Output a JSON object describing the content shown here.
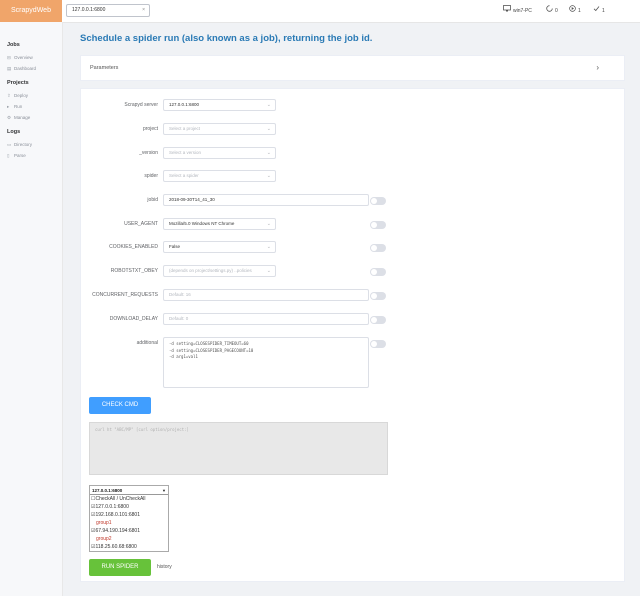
{
  "app": {
    "logo": "ScrapydWeb"
  },
  "topbar": {
    "server_tab": "127.0.0.1:6800",
    "close": "×",
    "pc_label": "win7-PC",
    "pending": "0",
    "running": "1",
    "finished": "1"
  },
  "sidebar": {
    "sections": [
      {
        "title": "Jobs",
        "items": [
          "Overview",
          "Dashboard"
        ]
      },
      {
        "title": "Projects",
        "items": [
          "Deploy",
          "Run",
          "Manage"
        ]
      },
      {
        "title": "Logs",
        "items": [
          "Directory",
          "Parse"
        ]
      }
    ]
  },
  "page": {
    "title": "Schedule a spider run (also known as a job), returning the job id."
  },
  "parameters": {
    "label": "Parameters",
    "chevron": "›"
  },
  "form": {
    "fields": [
      {
        "label": "Scrapyd server",
        "value": "127.0.0.1:6800",
        "placeholder": false,
        "arrow": true
      },
      {
        "label": "project",
        "value": "Select a project",
        "placeholder": true,
        "arrow": true
      },
      {
        "label": "_version",
        "value": "Select a version",
        "placeholder": true,
        "arrow": true
      },
      {
        "label": "spider",
        "value": "Select a spider",
        "placeholder": true,
        "arrow": true
      },
      {
        "label": "jobid",
        "value": "2018-09-30T14_41_30",
        "placeholder": false,
        "arrow": false
      },
      {
        "label": "USER_AGENT",
        "value": "Mozilla/5.0 Windows NT Chrome",
        "placeholder": false,
        "arrow": true
      },
      {
        "label": "COOKIES_ENABLED",
        "value": "False",
        "placeholder": false,
        "arrow": true
      },
      {
        "label": "ROBOTSTXT_OBEY",
        "value": "(depends on project/settings.py) ..policies",
        "placeholder": true,
        "arrow": true
      },
      {
        "label": "CONCURRENT_REQUESTS",
        "value": "Default: 16",
        "placeholder": true,
        "arrow": false
      },
      {
        "label": "DOWNLOAD_DELAY",
        "value": "Default: 0",
        "placeholder": true,
        "arrow": false
      }
    ],
    "additional": {
      "label": "additional",
      "lines": [
        "-d setting=CLOSESPIDER_TIMEOUT=60",
        "-d setting=CLOSESPIDER_PAGECOUNT=10",
        "-d arg1=val1"
      ]
    }
  },
  "buttons": {
    "check_cmd": "CHECK CMD",
    "run_spider": "RUN SPIDER",
    "history": "history"
  },
  "cmd_preview": "curl ht  \"ABC/MP\"  [curl option/project:]",
  "nodes": {
    "selected": "127.0.0.1:6800",
    "arrow": "▼",
    "options": [
      {
        "text": "☐CheckAll / UnCheckAll",
        "group": false
      },
      {
        "text": "☑127.0.0.1:6800",
        "group": false
      },
      {
        "text": "☑192.168.0.101:6801",
        "group": false
      },
      {
        "text": "group1",
        "group": true
      },
      {
        "text": "☑67.94.190.194:6801",
        "group": false
      },
      {
        "text": "group2",
        "group": true
      },
      {
        "text": "☑118.25.60.68:6800",
        "group": false
      }
    ]
  },
  "colors": {
    "accent": "#409eff",
    "success": "#67c23a",
    "title": "#2a7ab5",
    "logo_bg": "#f0a56a"
  }
}
